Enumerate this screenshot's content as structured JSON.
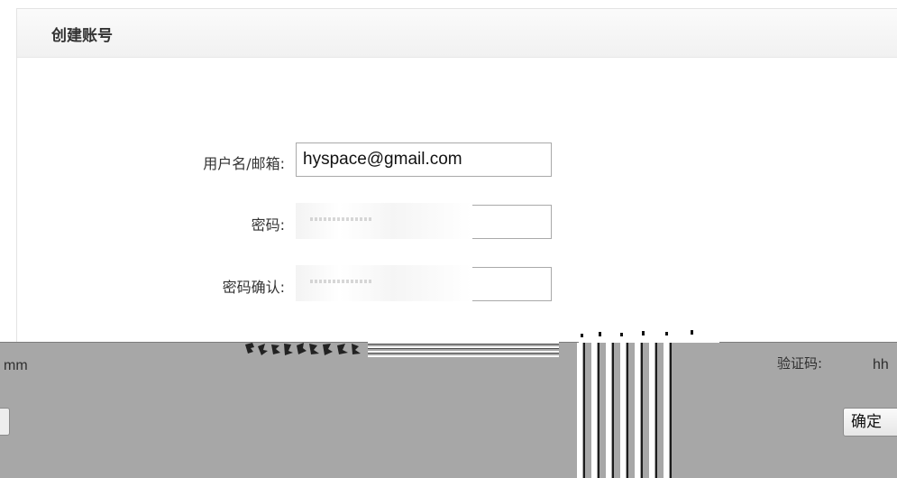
{
  "form": {
    "title": "创建账号",
    "username": {
      "label": "用户名/邮箱:",
      "value": "hyspace@gmail.com"
    },
    "password": {
      "label": "密码:"
    },
    "password_confirm": {
      "label": "密码确认:"
    }
  },
  "overlay": {
    "left_text": "mm",
    "captcha_label": "验证码:",
    "captcha_value": "hh",
    "confirm_label": "确定"
  }
}
